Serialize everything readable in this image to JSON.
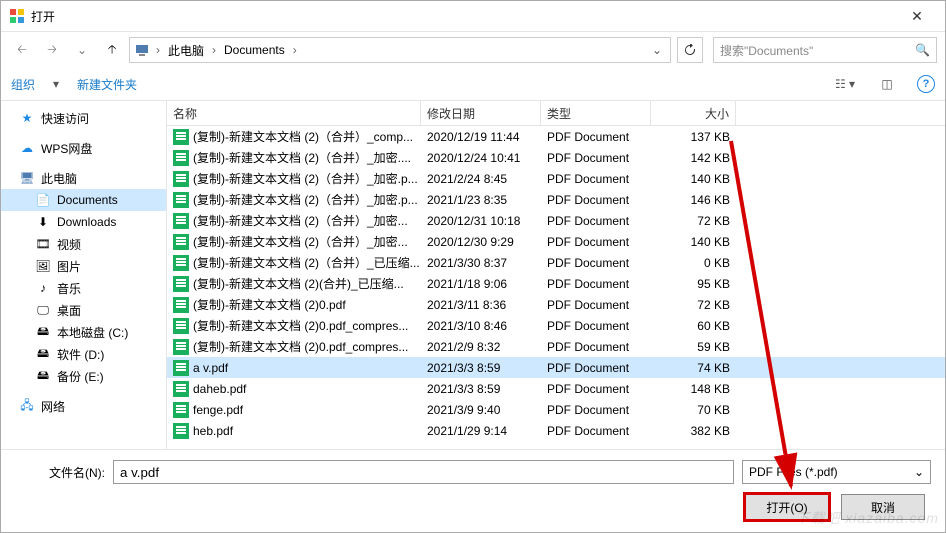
{
  "title": "打开",
  "breadcrumb": {
    "root": "此电脑",
    "folder": "Documents"
  },
  "search_placeholder": "搜索\"Documents\"",
  "toolbar": {
    "organize": "组织",
    "newfolder": "新建文件夹"
  },
  "sidebar": {
    "quick": "快速访问",
    "wps": "WPS网盘",
    "pc": "此电脑",
    "pc_children": [
      {
        "label": "Documents",
        "selected": true
      },
      {
        "label": "Downloads"
      },
      {
        "label": "视频"
      },
      {
        "label": "图片"
      },
      {
        "label": "音乐"
      },
      {
        "label": "桌面"
      },
      {
        "label": "本地磁盘 (C:)"
      },
      {
        "label": "软件 (D:)"
      },
      {
        "label": "备份 (E:)"
      }
    ],
    "network": "网络"
  },
  "columns": {
    "name": "名称",
    "date": "修改日期",
    "type": "类型",
    "size": "大小"
  },
  "files": [
    {
      "name": "(复制)-新建文本文档 (2)（合并）_comp...",
      "date": "2020/12/19 11:44",
      "type": "PDF Document",
      "size": "137 KB"
    },
    {
      "name": "(复制)-新建文本文档 (2)（合并）_加密....",
      "date": "2020/12/24 10:41",
      "type": "PDF Document",
      "size": "142 KB"
    },
    {
      "name": "(复制)-新建文本文档 (2)（合并）_加密.p...",
      "date": "2021/2/24 8:45",
      "type": "PDF Document",
      "size": "140 KB"
    },
    {
      "name": "(复制)-新建文本文档 (2)（合并）_加密.p...",
      "date": "2021/1/23 8:35",
      "type": "PDF Document",
      "size": "146 KB"
    },
    {
      "name": "(复制)-新建文本文档 (2)（合并）_加密...",
      "date": "2020/12/31 10:18",
      "type": "PDF Document",
      "size": "72 KB"
    },
    {
      "name": "(复制)-新建文本文档 (2)（合并）_加密...",
      "date": "2020/12/30 9:29",
      "type": "PDF Document",
      "size": "140 KB"
    },
    {
      "name": "(复制)-新建文本文档 (2)（合并）_已压缩...",
      "date": "2021/3/30 8:37",
      "type": "PDF Document",
      "size": "0 KB"
    },
    {
      "name": "(复制)-新建文本文档 (2)(合并)_已压缩...",
      "date": "2021/1/18 9:06",
      "type": "PDF Document",
      "size": "95 KB"
    },
    {
      "name": "(复制)-新建文本文档 (2)0.pdf",
      "date": "2021/3/11 8:36",
      "type": "PDF Document",
      "size": "72 KB"
    },
    {
      "name": "(复制)-新建文本文档 (2)0.pdf_compres...",
      "date": "2021/3/10 8:46",
      "type": "PDF Document",
      "size": "60 KB"
    },
    {
      "name": "(复制)-新建文本文档 (2)0.pdf_compres...",
      "date": "2021/2/9 8:32",
      "type": "PDF Document",
      "size": "59 KB"
    },
    {
      "name": "a v.pdf",
      "date": "2021/3/3 8:59",
      "type": "PDF Document",
      "size": "74 KB",
      "selected": true
    },
    {
      "name": "daheb.pdf",
      "date": "2021/3/3 8:59",
      "type": "PDF Document",
      "size": "148 KB"
    },
    {
      "name": "fenge.pdf",
      "date": "2021/3/9 9:40",
      "type": "PDF Document",
      "size": "70 KB"
    },
    {
      "name": "heb.pdf",
      "date": "2021/1/29 9:14",
      "type": "PDF Document",
      "size": "382 KB"
    }
  ],
  "footer": {
    "filename_label": "文件名(N):",
    "filename_value": "a v.pdf",
    "filetype": "PDF Files (*.pdf)",
    "open": "打开(O)",
    "cancel": "取消"
  },
  "watermark": "下载吧 xiazaiba.com"
}
